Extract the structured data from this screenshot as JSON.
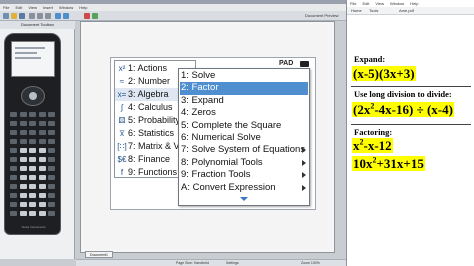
{
  "ti_app": {
    "menubar": [
      "File",
      "Edit",
      "View",
      "Insert",
      "Window",
      "Help"
    ],
    "handheld_header": "Document Toolbox",
    "handheld_brand": "Texas Instruments",
    "document_label": "Document Preview",
    "status_pad": "PAD",
    "main_menu": [
      {
        "label": "1: Actions",
        "icon": "actions-icon",
        "glyph": "x²"
      },
      {
        "label": "2: Number",
        "icon": "number-icon",
        "glyph": "≈"
      },
      {
        "label": "3: Algebra",
        "icon": "algebra-icon",
        "glyph": "x=",
        "selected": true
      },
      {
        "label": "4: Calculus",
        "icon": "calculus-icon",
        "glyph": "∫"
      },
      {
        "label": "5: Probability",
        "icon": "probability-icon",
        "glyph": "⚄"
      },
      {
        "label": "6: Statistics",
        "icon": "statistics-icon",
        "glyph": "x̅"
      },
      {
        "label": "7: Matrix & Vector",
        "icon": "matrix-icon",
        "glyph": "[∷]"
      },
      {
        "label": "8: Finance",
        "icon": "finance-icon",
        "glyph": "$€"
      },
      {
        "label": "9: Functions & Programs",
        "icon": "functions-icon",
        "glyph": "f"
      }
    ],
    "submenu": [
      {
        "label": "1: Solve",
        "arrow": false
      },
      {
        "label": "2: Factor",
        "arrow": false,
        "selected": true
      },
      {
        "label": "3: Expand",
        "arrow": false
      },
      {
        "label": "4: Zeros",
        "arrow": false
      },
      {
        "label": "5: Complete the Square",
        "arrow": false
      },
      {
        "label": "6: Numerical Solve",
        "arrow": false
      },
      {
        "label": "7: Solve System of Equations",
        "arrow": true
      },
      {
        "label": "8: Polynomial Tools",
        "arrow": true
      },
      {
        "label": "9: Fraction Tools",
        "arrow": true
      },
      {
        "label": "A: Convert Expression",
        "arrow": true
      }
    ],
    "statusbar": [
      "Page Size: Handheld",
      "Settings",
      "Zoom 100%"
    ],
    "tab_label": "Document1"
  },
  "pdf_app": {
    "menubar": [
      "File",
      "Edit",
      "View",
      "Window",
      "Help"
    ],
    "toolbar": [
      "Home",
      "Tools",
      "Ame.pdf"
    ],
    "expand_label": "Expand:",
    "expand_expr": "(x-5)(3x+3)",
    "long_division_label": "Use long division to divide:",
    "division_expr": {
      "pre": "(2x",
      "sup": "2",
      "post": "-4x-16) ÷ (x-4)"
    },
    "factoring_label": "Factoring:",
    "factor_expr1": {
      "pre": "x",
      "sup": "2",
      "post": "-x-12"
    },
    "factor_expr2": {
      "pre": "10x",
      "sup": "2",
      "post": "+31x+15"
    }
  },
  "colors": {
    "selection_blue": "#4f8fd0",
    "highlight_yellow": "#ffff00",
    "icon_blue": "#1b4f8a"
  }
}
